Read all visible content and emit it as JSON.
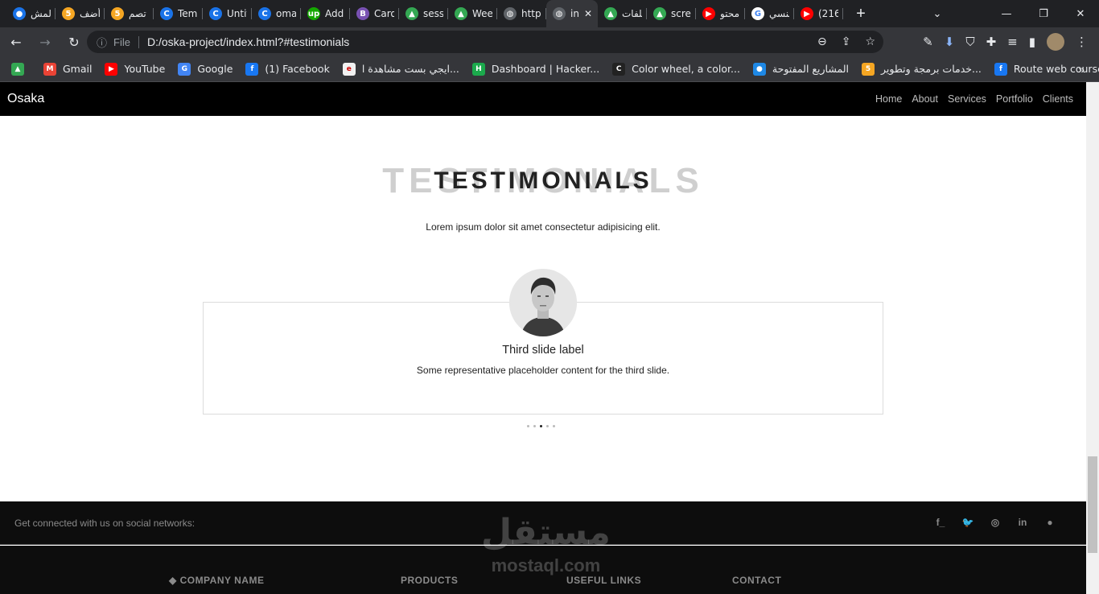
{
  "browser": {
    "tabs": [
      {
        "title": "المش",
        "color": "#1a73e8",
        "glyph": "●"
      },
      {
        "title": "أضف",
        "color": "#f5a623",
        "glyph": "5"
      },
      {
        "title": "تصم",
        "color": "#f5a623",
        "glyph": "5"
      },
      {
        "title": "Temp",
        "color": "#1a73e8",
        "glyph": "C"
      },
      {
        "title": "Untit",
        "color": "#1a73e8",
        "glyph": "C"
      },
      {
        "title": "oma",
        "color": "#1a73e8",
        "glyph": "C"
      },
      {
        "title": "Add",
        "color": "#14a800",
        "glyph": "up"
      },
      {
        "title": "Caro",
        "color": "#7952b3",
        "glyph": "B"
      },
      {
        "title": "sessi",
        "color": "#34a853",
        "glyph": "▲"
      },
      {
        "title": "Wee",
        "color": "#34a853",
        "glyph": "▲"
      },
      {
        "title": "https",
        "color": "#5f6368",
        "glyph": "◍"
      },
      {
        "title": "in",
        "color": "#5f6368",
        "glyph": "◍",
        "active": true
      },
      {
        "title": "ملفات",
        "color": "#34a853",
        "glyph": "▲"
      },
      {
        "title": "scree",
        "color": "#34a853",
        "glyph": "▲"
      },
      {
        "title": "محتو",
        "color": "#ff0000",
        "glyph": "▶"
      },
      {
        "title": "تنسي",
        "color": "#ffffff",
        "glyph": "G"
      },
      {
        "title": "(216",
        "color": "#ff0000",
        "glyph": "▶"
      }
    ],
    "url_scheme": "File",
    "url": "D:/oska-project/index.html?#testimonials",
    "bookmarks": [
      {
        "label": "",
        "color": "#34a853",
        "glyph": "▲"
      },
      {
        "label": "Gmail",
        "color": "#ea4335",
        "glyph": "M"
      },
      {
        "label": "YouTube",
        "color": "#ff0000",
        "glyph": "▶"
      },
      {
        "label": "Google",
        "color": "#4285f4",
        "glyph": "G"
      },
      {
        "label": "(1) Facebook",
        "color": "#1877f2",
        "glyph": "f"
      },
      {
        "label": "ايجي بست مشاهدة ا...",
        "color": "#f1f1f1",
        "glyph": "e"
      },
      {
        "label": "Dashboard | Hacker...",
        "color": "#1ba94c",
        "glyph": "H"
      },
      {
        "label": "Color wheel, a color...",
        "color": "#222222",
        "glyph": "C"
      },
      {
        "label": "المشاريع المفتوحة",
        "color": "#1e88e5",
        "glyph": "●"
      },
      {
        "label": "خدمات برمجة وتطوير...",
        "color": "#f5a623",
        "glyph": "5"
      },
      {
        "label": "Route web courses...",
        "color": "#1877f2",
        "glyph": "f"
      }
    ]
  },
  "site": {
    "brand": "Osaka",
    "nav": [
      "Home",
      "About",
      "Services",
      "Portfolio",
      "Clients"
    ],
    "section": {
      "bg_title": "TESTIMONIALS",
      "title": "TESTIMONIALS",
      "subtitle": "Lorem ipsum dolor sit amet consectetur adipisicing elit."
    },
    "slide": {
      "label": "Third slide label",
      "text": "Some representative placeholder content for the third slide.",
      "indicator_count": 5,
      "active_indicator": 3
    },
    "footer": {
      "social_text": "Get connected with us on social networks:",
      "social_icons": [
        "facebook-icon",
        "twitter-icon",
        "instagram-icon",
        "linkedin-icon",
        "github-icon"
      ],
      "columns": [
        "COMPANY NAME",
        "PRODUCTS",
        "USEFUL LINKS",
        "CONTACT"
      ]
    },
    "watermark": {
      "arabic": "مستقل",
      "latin": "mostaql.com"
    }
  }
}
